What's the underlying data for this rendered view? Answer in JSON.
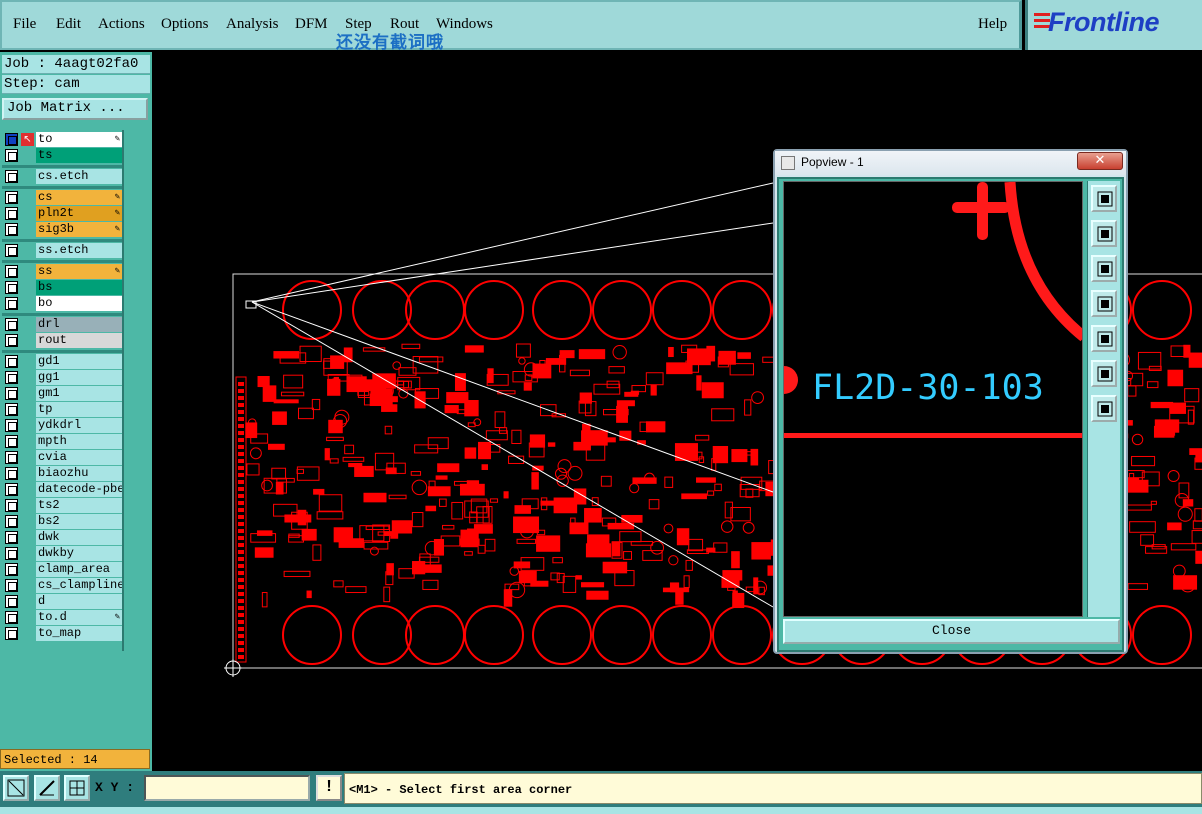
{
  "menu": {
    "items": [
      {
        "label": "File"
      },
      {
        "label": "Edit"
      },
      {
        "label": "Actions"
      },
      {
        "label": "Options"
      },
      {
        "label": "Analysis"
      },
      {
        "label": "DFM"
      },
      {
        "label": "Step"
      },
      {
        "label": "Rout"
      },
      {
        "label": "Windows"
      },
      {
        "label": "Help"
      }
    ],
    "overlay_text": "还没有截词哦",
    "brand": "Frontline"
  },
  "panel": {
    "job": "Job : 4aagt02fa0",
    "step": "Step: cam",
    "job_matrix_label": "Job Matrix ...",
    "selected": "Selected : 14"
  },
  "layers": [
    {
      "name": "to",
      "color": "#ffffff",
      "locked": true
    },
    {
      "name": "ts",
      "color": "#00a078",
      "locked": false
    },
    {
      "name": "cs.etch",
      "color": "#a8e4e4",
      "locked": false
    },
    {
      "name": "cs",
      "color": "#f2b33c",
      "locked": true
    },
    {
      "name": "pln2t",
      "color": "#e0a020",
      "locked": true
    },
    {
      "name": "sig3b",
      "color": "#f2b33c",
      "locked": true
    },
    {
      "name": "ss.etch",
      "color": "#a8e4e4",
      "locked": false
    },
    {
      "name": "ss",
      "color": "#f2b33c",
      "locked": true
    },
    {
      "name": "bs",
      "color": "#00a078",
      "locked": false
    },
    {
      "name": "bo",
      "color": "#ffffff",
      "locked": false
    },
    {
      "name": "drl",
      "color": "#98b0b8",
      "locked": false
    },
    {
      "name": "rout",
      "color": "#d8d8d8",
      "locked": false
    },
    {
      "name": "gd1",
      "color": "#a8e4e4",
      "locked": false
    },
    {
      "name": "gg1",
      "color": "#a8e4e4",
      "locked": false
    },
    {
      "name": "gm1",
      "color": "#a8e4e4",
      "locked": false
    },
    {
      "name": "tp",
      "color": "#a8e4e4",
      "locked": false
    },
    {
      "name": "ydkdrl",
      "color": "#a8e4e4",
      "locked": false
    },
    {
      "name": "mpth",
      "color": "#a8e4e4",
      "locked": false
    },
    {
      "name": "cvia",
      "color": "#a8e4e4",
      "locked": false
    },
    {
      "name": "biaozhu",
      "color": "#a8e4e4",
      "locked": false
    },
    {
      "name": "datecode-pbe",
      "color": "#a8e4e4",
      "locked": false
    },
    {
      "name": "ts2",
      "color": "#a8e4e4",
      "locked": false
    },
    {
      "name": "bs2",
      "color": "#a8e4e4",
      "locked": false
    },
    {
      "name": "dwk",
      "color": "#a8e4e4",
      "locked": false
    },
    {
      "name": "dwkby",
      "color": "#a8e4e4",
      "locked": false
    },
    {
      "name": "clamp_area",
      "color": "#a8e4e4",
      "locked": false
    },
    {
      "name": "cs_clampline",
      "color": "#a8e4e4",
      "locked": false
    },
    {
      "name": "d",
      "color": "#a8e4e4",
      "locked": false
    },
    {
      "name": "to.d",
      "color": "#a8e4e4",
      "locked": true
    },
    {
      "name": "to_map",
      "color": "#a8e4e4",
      "locked": false
    }
  ],
  "bottom": {
    "xy_label": "X Y :",
    "xy_value": "",
    "message": "<M1> - Select first area corner"
  },
  "popview": {
    "title": "Popview - 1",
    "close_label": "Close",
    "label_text": "FL2D-30-103"
  },
  "colors": {
    "pcb": "#ff0000",
    "panel": "#a8e4e4",
    "accent": "#4db8a6",
    "label": "#33ccff"
  }
}
